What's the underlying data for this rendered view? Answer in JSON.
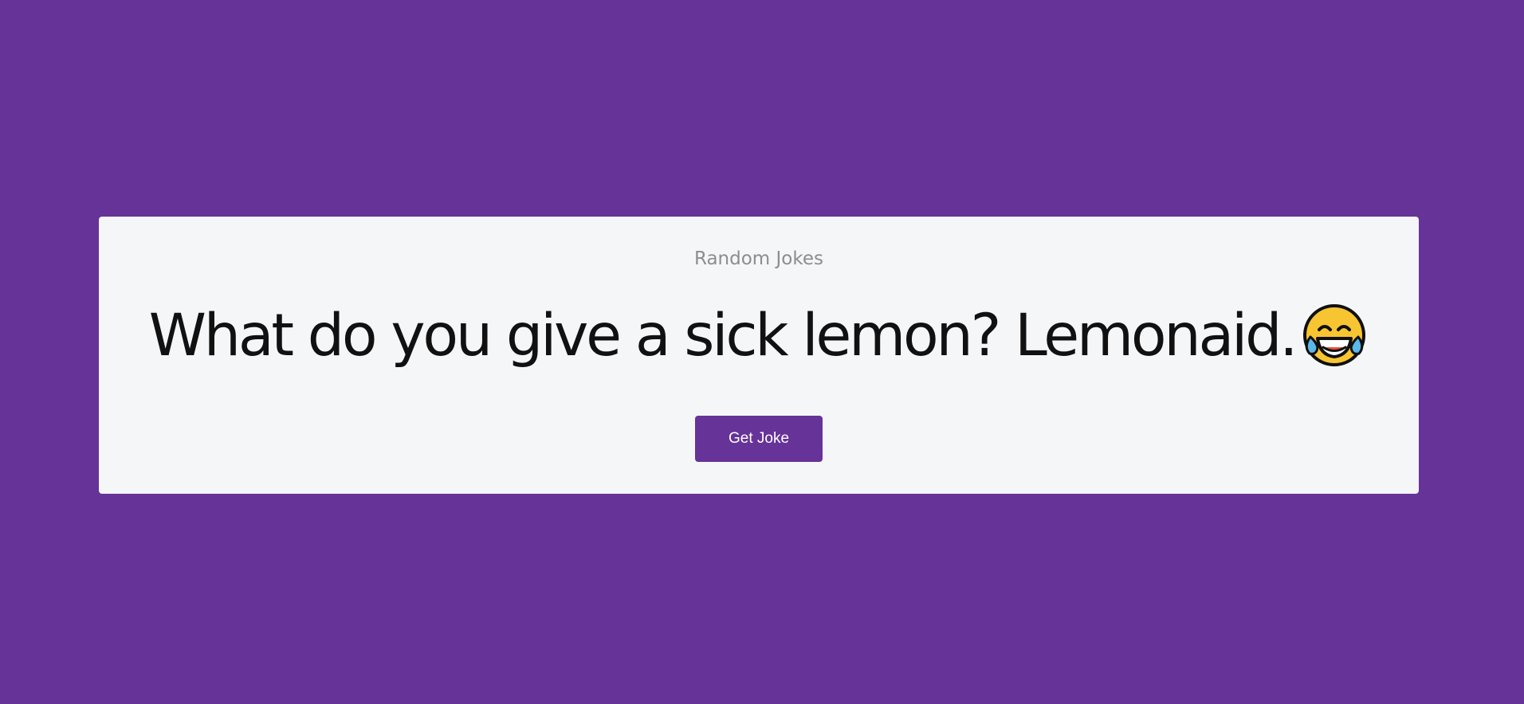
{
  "app": {
    "subtitle": "Random Jokes",
    "joke": "What do you give a sick lemon? Lemonaid.",
    "emoji_icon": "face-with-tears-of-joy-icon",
    "button_label": "Get Joke"
  },
  "colors": {
    "background": "#663399",
    "card": "#f5f6f8",
    "subtitle": "#8d8d8d",
    "joke_text": "#111111",
    "button": "#663399",
    "button_text": "#ffffff"
  }
}
